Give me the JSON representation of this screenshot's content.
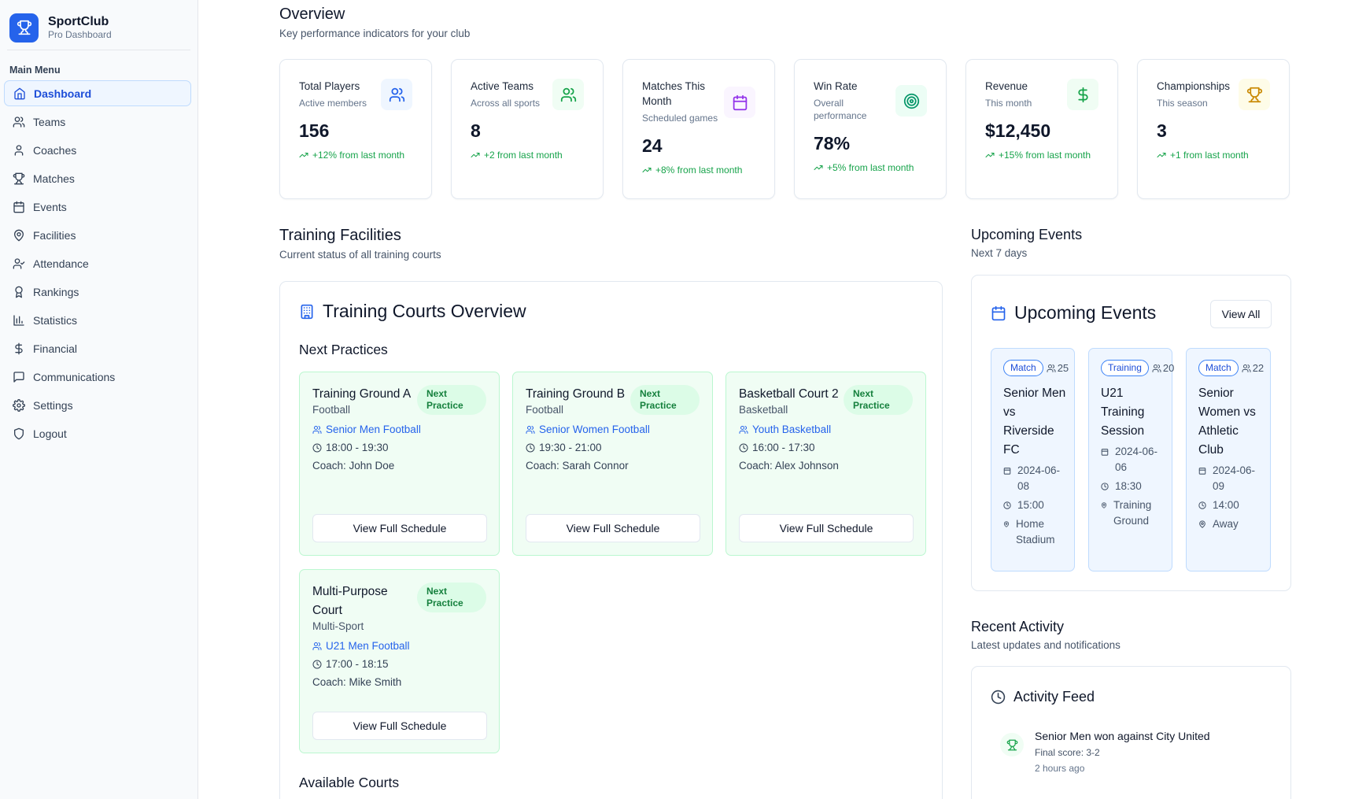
{
  "brand": {
    "title": "SportClub",
    "subtitle": "Pro Dashboard",
    "logo_icon": "trophy-icon"
  },
  "sidebar": {
    "heading": "Main Menu",
    "items": [
      {
        "label": "Dashboard",
        "icon": "home-icon",
        "active": true
      },
      {
        "label": "Teams",
        "icon": "users-icon"
      },
      {
        "label": "Coaches",
        "icon": "user-icon"
      },
      {
        "label": "Matches",
        "icon": "trophy-icon"
      },
      {
        "label": "Events",
        "icon": "calendar-icon"
      },
      {
        "label": "Facilities",
        "icon": "map-pin-icon"
      },
      {
        "label": "Attendance",
        "icon": "user-check-icon"
      },
      {
        "label": "Rankings",
        "icon": "award-icon"
      },
      {
        "label": "Statistics",
        "icon": "bar-chart-icon"
      },
      {
        "label": "Financial",
        "icon": "dollar-icon"
      },
      {
        "label": "Communications",
        "icon": "message-icon"
      },
      {
        "label": "Settings",
        "icon": "gear-icon"
      },
      {
        "label": "Logout",
        "icon": "shield-icon"
      }
    ]
  },
  "overview": {
    "title": "Overview",
    "subtitle": "Key performance indicators for your club",
    "stats": [
      {
        "label": "Total Players",
        "desc": "Active members",
        "value": "156",
        "change": "+12% from last month",
        "icon": "users-icon",
        "icon_color": "#2563eb",
        "icon_bg": "#eff6ff"
      },
      {
        "label": "Active Teams",
        "desc": "Across all sports",
        "value": "8",
        "change": "+2 from last month",
        "icon": "users-icon",
        "icon_color": "#16a34a",
        "icon_bg": "#f0fdf4"
      },
      {
        "label": "Matches This Month",
        "desc": "Scheduled games",
        "value": "24",
        "change": "+8% from last month",
        "icon": "calendar-icon",
        "icon_color": "#9333ea",
        "icon_bg": "#faf5ff"
      },
      {
        "label": "Win Rate",
        "desc": "Overall performance",
        "value": "78%",
        "change": "+5% from last month",
        "icon": "target-icon",
        "icon_color": "#059669",
        "icon_bg": "#ecfdf5"
      },
      {
        "label": "Revenue",
        "desc": "This month",
        "value": "$12,450",
        "change": "+15% from last month",
        "icon": "dollar-icon",
        "icon_color": "#16a34a",
        "icon_bg": "#f0fdf4"
      },
      {
        "label": "Championships",
        "desc": "This season",
        "value": "3",
        "change": "+1 from last month",
        "icon": "trophy-icon",
        "icon_color": "#ca8a04",
        "icon_bg": "#fefce8"
      }
    ]
  },
  "facilities": {
    "title": "Training Facilities",
    "subtitle": "Current status of all training courts",
    "panel_title": "Training Courts Overview",
    "next_heading": "Next Practices",
    "available_heading": "Available Courts",
    "courts": [
      {
        "name": "Training Ground A",
        "badge": "Next Practice",
        "sport": "Football",
        "team": "Senior Men Football",
        "time": "18:00 - 19:30",
        "coach": "Coach: John Doe",
        "button": "View Full Schedule"
      },
      {
        "name": "Training Ground B",
        "badge": "Next Practice",
        "sport": "Football",
        "team": "Senior Women Football",
        "time": "19:30 - 21:00",
        "coach": "Coach: Sarah Connor",
        "button": "View Full Schedule"
      },
      {
        "name": "Basketball Court 2",
        "badge": "Next Practice",
        "sport": "Basketball",
        "team": "Youth Basketball",
        "time": "16:00 - 17:30",
        "coach": "Coach: Alex Johnson",
        "button": "View Full Schedule"
      },
      {
        "name": "Multi-Purpose Court",
        "badge": "Next Practice",
        "sport": "Multi-Sport",
        "team": "U21 Men Football",
        "time": "17:00 - 18:15",
        "coach": "Coach: Mike Smith",
        "button": "View Full Schedule"
      }
    ]
  },
  "upcoming": {
    "title": "Upcoming Events",
    "subtitle": "Next 7 days",
    "panel_title": "Upcoming Events",
    "view_all": "View All",
    "events": [
      {
        "type": "Match",
        "count": "25",
        "name": "Senior Men vs Riverside FC",
        "date": "2024-06-08",
        "time": "15:00",
        "location": "Home Stadium"
      },
      {
        "type": "Training",
        "count": "20",
        "name": "U21 Training Session",
        "date": "2024-06-06",
        "time": "18:30",
        "location": "Training Ground"
      },
      {
        "type": "Match",
        "count": "22",
        "name": "Senior Women vs Athletic Club",
        "date": "2024-06-09",
        "time": "14:00",
        "location": "Away"
      }
    ]
  },
  "activity": {
    "title": "Recent Activity",
    "subtitle": "Latest updates and notifications",
    "panel_title": "Activity Feed",
    "items": [
      {
        "title": "Senior Men won against City United",
        "detail": "Final score: 3-2",
        "time": "2 hours ago",
        "icon": "trophy-icon"
      }
    ]
  }
}
